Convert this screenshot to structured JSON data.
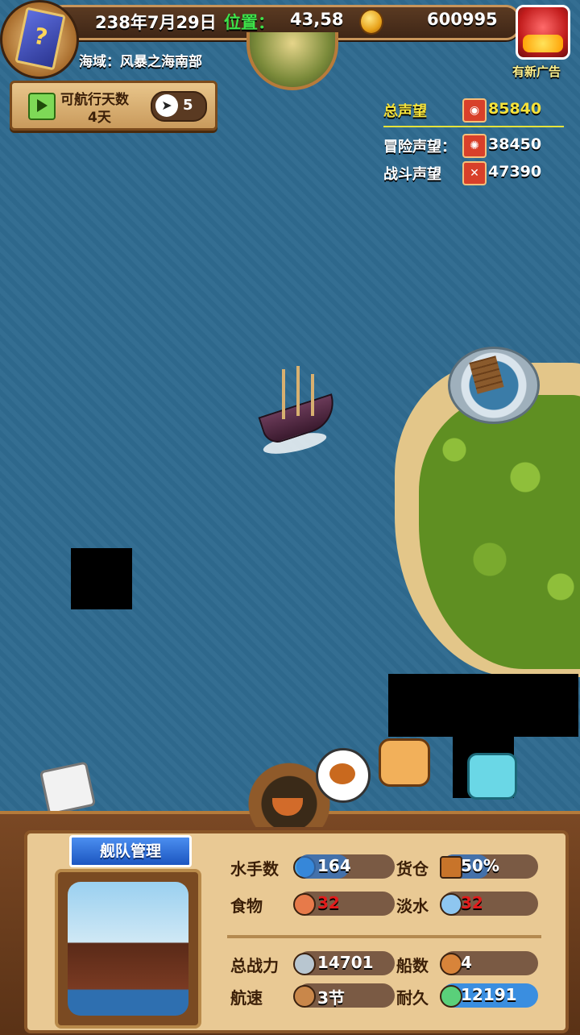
{
  "header": {
    "date": "238年7月29日",
    "position_label": "位置：",
    "position_value": "43,58",
    "gold": "600995",
    "region": "海域：风暴之海南部",
    "ad_label": "有新广告"
  },
  "sail": {
    "label": "可航行天数",
    "days": "4天",
    "compass_value": "5"
  },
  "reputation": {
    "total_label": "总声望",
    "total_value": "85840",
    "adventure_label": "冒险声望：",
    "adventure_value": "38450",
    "battle_label": "战斗声望",
    "battle_value": "47390",
    "colors": {
      "total": "#f5e23a",
      "other": "#ffffff"
    }
  },
  "fleet": {
    "title": "舰队管理",
    "stats": {
      "sailors_label": "水手数",
      "sailors_value": "164",
      "cargo_label": "货仓",
      "cargo_value": "50%",
      "food_label": "食物",
      "food_value": "32",
      "water_label": "淡水",
      "water_value": "32",
      "power_label": "总战力",
      "power_value": "14701",
      "ships_label": "船数",
      "ships_value": "4",
      "speed_label": "航速",
      "speed_value": "3节",
      "durability_label": "耐久",
      "durability_value": "12191"
    }
  },
  "icons": [
    "book-icon",
    "coin-icon",
    "globe-icon",
    "ad-chest-icon",
    "play-icon",
    "compass-arrow-icon",
    "reputation-shield-icon",
    "adventure-icon",
    "battle-icon",
    "ship-icon",
    "port-icon",
    "food-bubble-icon",
    "sailor-icon",
    "cargo-icon",
    "food-icon",
    "water-icon",
    "power-icon",
    "ship-count-icon",
    "speed-icon",
    "durability-icon"
  ]
}
